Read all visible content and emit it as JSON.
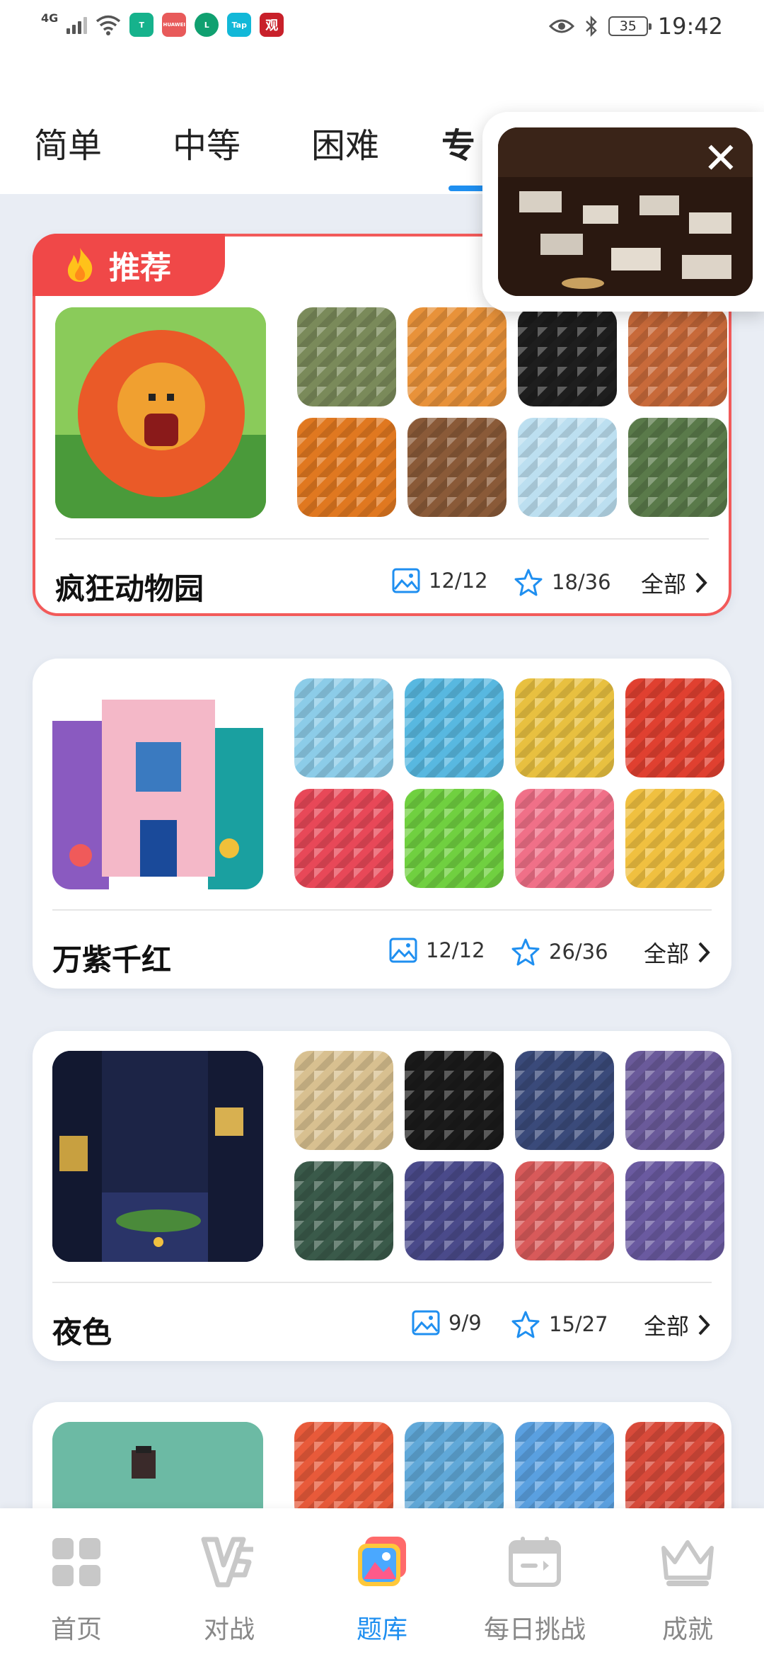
{
  "status_bar": {
    "network": "4G",
    "app_icons": [
      "T",
      "HUAWEI",
      "L",
      "Tap",
      "观"
    ],
    "battery": "35",
    "time": "19:42"
  },
  "tabs": [
    {
      "label": "简单",
      "active": false
    },
    {
      "label": "中等",
      "active": false
    },
    {
      "label": "困难",
      "active": false
    },
    {
      "label": "专",
      "active": true
    }
  ],
  "video": {
    "close": "✕"
  },
  "cards": [
    {
      "recommended": true,
      "badge": "推荐",
      "title": "疯狂动物园",
      "images": "12/12",
      "stars": "18/36",
      "all": "全部",
      "thumb_colors": [
        "#7a8a5a",
        "#e8923a",
        "#1e1e1e",
        "#c86a3a",
        "#e07820",
        "#8a5a38",
        "#bcdff0",
        "#5a7a4a"
      ]
    },
    {
      "recommended": false,
      "title": "万紫千红",
      "images": "12/12",
      "stars": "26/36",
      "all": "全部",
      "thumb_colors": [
        "#8ccce8",
        "#58b8e0",
        "#e8c040",
        "#e04030",
        "#e84858",
        "#70d040",
        "#f07088",
        "#f0c040"
      ]
    },
    {
      "recommended": false,
      "title": "夜色",
      "images": "9/9",
      "stars": "15/27",
      "all": "全部",
      "thumb_colors": [
        "#d8c090",
        "#1a1a1a",
        "#3a4a7a",
        "#6a5a9a",
        "#3a5a4a",
        "#4a4a8a",
        "#d85a5a",
        "#6a5aa0"
      ]
    },
    {
      "recommended": false,
      "title": "",
      "images": "",
      "stars": "",
      "all": "",
      "thumb_colors": [
        "#e85a3a",
        "#60a8d8",
        "#5aa0e0",
        "#d84a3a"
      ]
    }
  ],
  "bottom_nav": [
    {
      "label": "首页",
      "icon": "home-grid-icon",
      "active": false
    },
    {
      "label": "对战",
      "icon": "vs-icon",
      "active": false
    },
    {
      "label": "题库",
      "icon": "gallery-icon",
      "active": true
    },
    {
      "label": "每日挑战",
      "icon": "calendar-icon",
      "active": false
    },
    {
      "label": "成就",
      "icon": "crown-icon",
      "active": false
    }
  ],
  "colors": {
    "accent": "#1f8ff0",
    "recommend": "#f04848",
    "background": "#e9edf4"
  }
}
